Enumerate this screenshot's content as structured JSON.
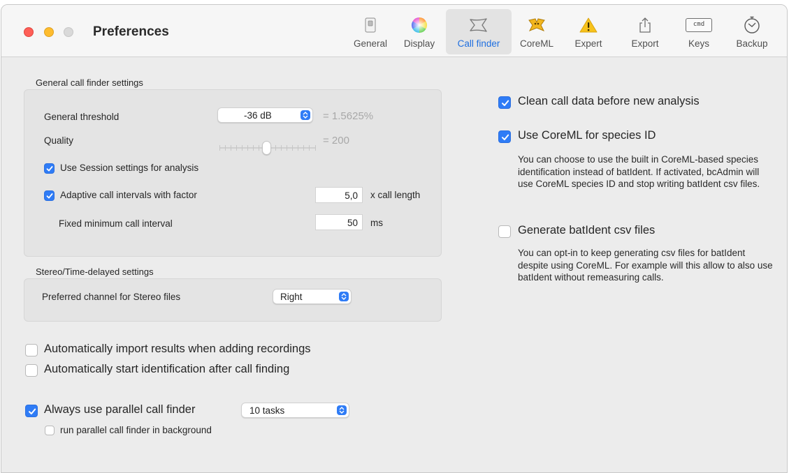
{
  "window": {
    "title": "Preferences"
  },
  "toolbar": {
    "items": [
      {
        "label": "General",
        "icon": "general-switch-icon"
      },
      {
        "label": "Display",
        "icon": "color-wheel-icon"
      },
      {
        "label": "Call finder",
        "icon": "bat-call-icon"
      },
      {
        "label": "CoreML",
        "icon": "coreml-icon"
      },
      {
        "label": "Expert",
        "icon": "warning-icon"
      },
      {
        "label": "Export",
        "icon": "share-icon"
      },
      {
        "label": "Keys",
        "icon": "cmd-key-icon"
      },
      {
        "label": "Backup",
        "icon": "timer-icon"
      }
    ],
    "active": "Call finder",
    "keys_icon_text": "cmd"
  },
  "general_settings": {
    "section_label": "General call finder settings",
    "threshold_label": "General threshold",
    "threshold_value": "-36 dB",
    "threshold_percent": "= 1.5625%",
    "quality_label": "Quality",
    "quality_value": "= 200",
    "quality_slider_fraction": 0.49,
    "use_session_label": "Use Session settings for analysis",
    "use_session_checked": true,
    "adaptive_label": "Adaptive call intervals with factor",
    "adaptive_checked": true,
    "adaptive_value": "5,0",
    "adaptive_unit": "x call length",
    "fixed_min_label": "Fixed minimum call interval",
    "fixed_min_value": "50",
    "fixed_min_unit": "ms"
  },
  "stereo_settings": {
    "section_label": "Stereo/Time-delayed settings",
    "channel_label": "Preferred channel for Stereo files",
    "channel_value": "Right"
  },
  "bottom_options": {
    "auto_import_label": "Automatically import results when adding recordings",
    "auto_import_checked": false,
    "auto_start_label": "Automatically start identification after call finding",
    "auto_start_checked": false,
    "parallel_label": "Always use parallel call finder",
    "parallel_checked": true,
    "parallel_tasks": "10 tasks",
    "background_label": "run parallel call finder in background",
    "background_checked": false
  },
  "right_options": {
    "clean_label": "Clean call data before new analysis",
    "clean_checked": true,
    "coreml_label": "Use CoreML for species ID",
    "coreml_checked": true,
    "coreml_desc": "You can choose to use the built in CoreML-based species identification instead of batIdent. If activated, bcAdmin will use CoreML species ID and stop writing batIdent csv files.",
    "csv_label": "Generate batIdent csv files",
    "csv_checked": false,
    "csv_desc": "You can opt-in to keep generating csv files for batIdent despite using CoreML. For example will this allow to also use batIdent without remeasuring calls."
  },
  "colors": {
    "accent": "#2f7cf6",
    "active_tab_label": "#1f6fe0",
    "window_bg": "#ececec",
    "group_bg": "#e4e4e4"
  }
}
